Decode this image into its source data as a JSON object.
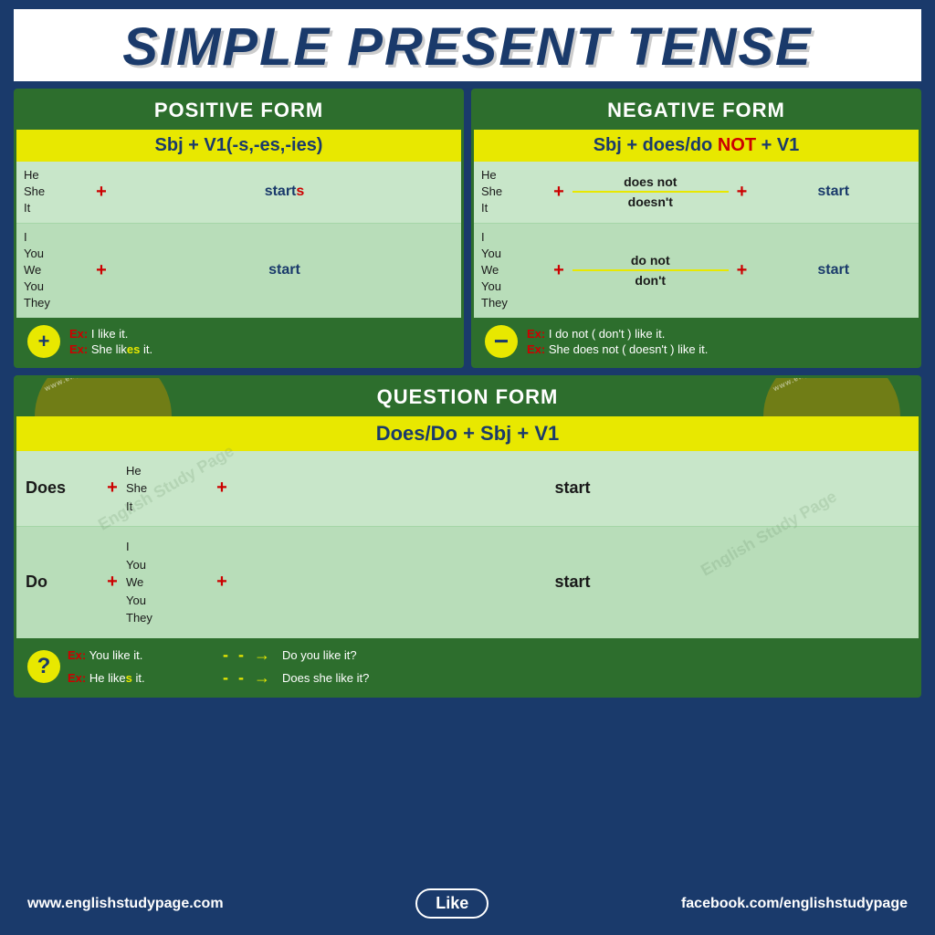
{
  "title": "SIMPLE PRESENT TENSE",
  "positive": {
    "header": "POSITIVE FORM",
    "formula": "Sbj + V1(-s,-es,-ies)",
    "rows": [
      {
        "subjects": [
          "He",
          "She",
          "It"
        ],
        "plus": "+",
        "verb": "starts",
        "verb_highlight": "s"
      },
      {
        "subjects": [
          "I",
          "You",
          "We",
          "You",
          "They"
        ],
        "plus": "+",
        "verb": "start",
        "verb_highlight": ""
      }
    ],
    "example_icon": "+",
    "examples": [
      "Ex: I like it.",
      "Ex: She likes it."
    ],
    "ex_highlight_index": [
      0,
      1
    ]
  },
  "negative": {
    "header": "NEGATIVE FORM",
    "formula_main": "Sbj + does/do ",
    "formula_not": "NOT",
    "formula_end": " + V1",
    "rows": [
      {
        "subjects": [
          "He",
          "She",
          "It"
        ],
        "plus": "+",
        "verb_top": "does not",
        "verb_bot": "doesn't",
        "verb2": "+",
        "verb_final": "start"
      },
      {
        "subjects": [
          "I",
          "You",
          "We",
          "You",
          "They"
        ],
        "plus": "+",
        "verb_top": "do not",
        "verb_bot": "don't",
        "verb2": "+",
        "verb_final": "start"
      }
    ],
    "example_icon": "-",
    "examples": [
      "Ex: I do not ( don't ) like it.",
      "Ex: She does not ( doesn't ) like it."
    ]
  },
  "question": {
    "header": "QUESTION FORM",
    "formula": "Does/Do +  Sbj + V1",
    "rows": [
      {
        "auxiliary": "Does",
        "plus": "+",
        "subjects": [
          "He",
          "She",
          "It"
        ],
        "plus2": "+",
        "verb": "start"
      },
      {
        "auxiliary": "Do",
        "plus": "+",
        "subjects": [
          "I",
          "You",
          "We",
          "You",
          "They"
        ],
        "plus2": "+",
        "verb": "start"
      }
    ],
    "example_icon": "?",
    "examples": [
      {
        "label": "Ex:",
        "text": " You like it.",
        "arrow": "- - →",
        "result": "Do you like it?"
      },
      {
        "label": "Ex:",
        "text": " He likes it.",
        "arrow": "- - →",
        "result": "Does she like it?"
      }
    ],
    "watermark": "www.englishstudypage.com"
  },
  "footer": {
    "website": "www.englishstudypage.com",
    "like": "Like",
    "facebook": "facebook.com/englishstudypage"
  }
}
